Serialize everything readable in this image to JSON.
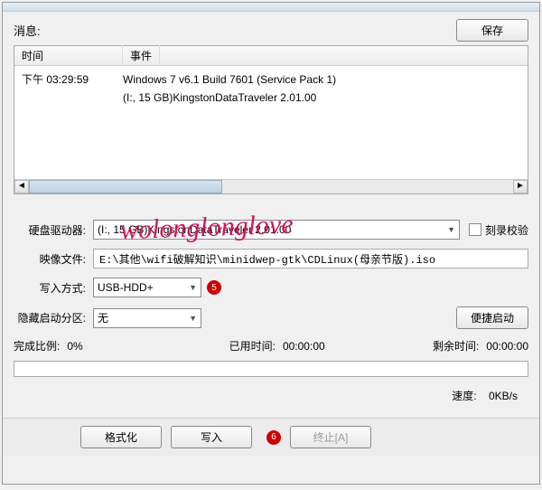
{
  "header": {
    "msg_label": "消息:",
    "save_label": "保存"
  },
  "log": {
    "col_time": "时间",
    "col_event": "事件",
    "entry_time": "下午 03:29:59",
    "event_line1": "Windows 7 v6.1 Build 7601 (Service Pack 1)",
    "event_line2": "(I:, 15 GB)KingstonDataTraveler 2.01.00"
  },
  "watermark": "wolonglonglove",
  "form": {
    "drive_label": "硬盘驱动器:",
    "drive_value": "(I:, 15 GB)KingstonDataTraveler 2.01.00",
    "verify_label": "刻录校验",
    "image_label": "映像文件:",
    "image_value": "E:\\其他\\wifi破解知识\\minidwep-gtk\\CDLinux(母亲节版).iso",
    "mode_label": "写入方式:",
    "mode_value": "USB-HDD+",
    "mode_badge": "5",
    "hide_label": "隐藏启动分区:",
    "hide_value": "无",
    "quickboot_label": "便捷启动"
  },
  "progress": {
    "ratio_label": "完成比例:",
    "ratio_value": "0%",
    "elapsed_label": "已用时间:",
    "elapsed_value": "00:00:00",
    "remain_label": "剩余时间:",
    "remain_value": "00:00:00",
    "speed_label": "速度:",
    "speed_value": "0KB/s"
  },
  "buttons": {
    "format": "格式化",
    "write": "写入",
    "write_badge": "6",
    "abort": "终止[A]"
  }
}
